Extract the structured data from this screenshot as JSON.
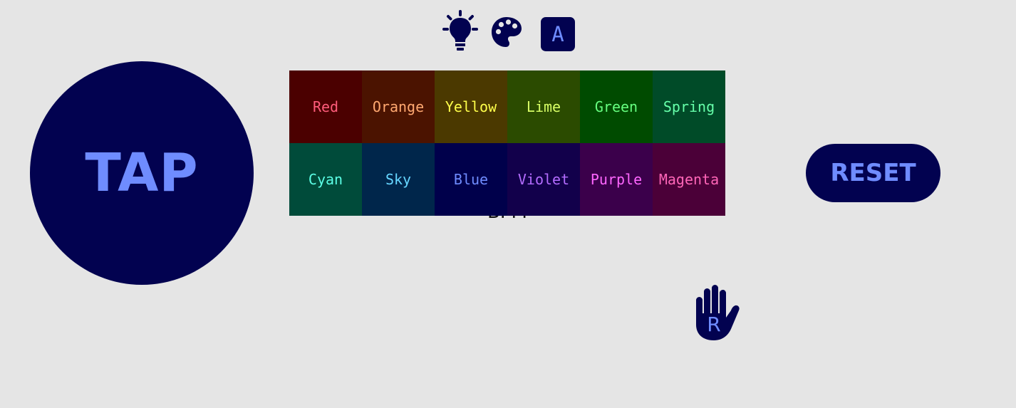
{
  "toolbar": {
    "icons": [
      "lightbulb-icon",
      "palette-icon",
      "font-icon"
    ],
    "font_label": "A"
  },
  "tap_button": {
    "label": "TAP"
  },
  "reset_button": {
    "label": "RESET"
  },
  "bpm": {
    "text": "BPM"
  },
  "hand_icon": {
    "letter": "R"
  },
  "palette": {
    "colors": [
      {
        "name": "Red",
        "bg": "#4b0000",
        "fg": "#ff5c7a"
      },
      {
        "name": "Orange",
        "bg": "#4b1300",
        "fg": "#ffa870"
      },
      {
        "name": "Yellow",
        "bg": "#4b3900",
        "fg": "#ffff4a"
      },
      {
        "name": "Lime",
        "bg": "#2b4b00",
        "fg": "#d8ff66"
      },
      {
        "name": "Green",
        "bg": "#004b00",
        "fg": "#66ff80"
      },
      {
        "name": "Spring",
        "bg": "#004b28",
        "fg": "#66ffaa"
      },
      {
        "name": "Cyan",
        "bg": "#004b3a",
        "fg": "#5cffe6"
      },
      {
        "name": "Sky",
        "bg": "#00264b",
        "fg": "#66d6ff"
      },
      {
        "name": "Blue",
        "bg": "#00004b",
        "fg": "#6f8cff"
      },
      {
        "name": "Violet",
        "bg": "#12004b",
        "fg": "#b46cff"
      },
      {
        "name": "Purple",
        "bg": "#3b004b",
        "fg": "#ff66ff"
      },
      {
        "name": "Magenta",
        "bg": "#4b0038",
        "fg": "#ff66b8"
      }
    ]
  },
  "theme": {
    "background": "#e5e5e5",
    "primary": "#020250",
    "accent": "#6f8cff"
  }
}
